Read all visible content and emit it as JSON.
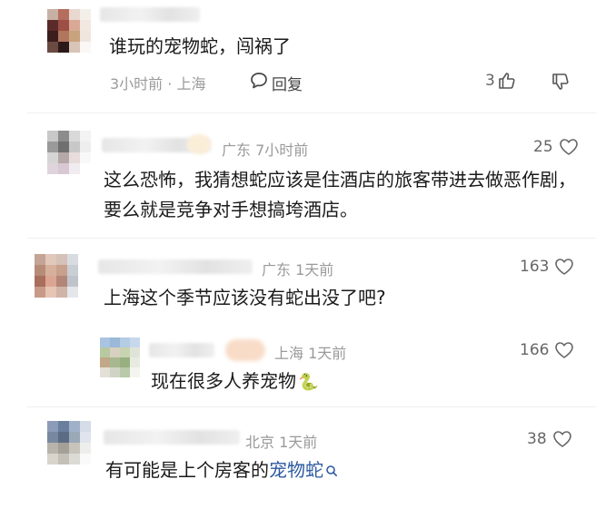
{
  "comments": [
    {
      "text": "谁玩的宠物蛇，闯祸了",
      "time_location": "3小时前 · 上海",
      "reply_label": "回复",
      "likes": "3"
    },
    {
      "meta": "广东 7小时前",
      "text": "这么恐怖，我猜想蛇应该是住酒店的旅客带进去做恶作剧，要么就是竞争对手想搞垮酒店。",
      "likes": "25"
    },
    {
      "meta": "广东 1天前",
      "text": "上海这个季节应该没有蛇出没了吧?",
      "likes": "163"
    },
    {
      "meta": "上海 1天前",
      "text": "现在很多人养宠物",
      "emoji": "🐍",
      "likes": "166"
    },
    {
      "meta": "北京 1天前",
      "text_before": "有可能是上个房客的",
      "text_link": "宠物蛇",
      "likes": "38"
    }
  ],
  "icons": {
    "reply": "speech-bubble-icon",
    "like": "thumbs-up-icon",
    "dislike": "thumbs-down-icon",
    "heart": "heart-icon",
    "search": "search-icon"
  },
  "colors": {
    "link": "#2c5aa0",
    "meta": "#9a9a9a"
  }
}
